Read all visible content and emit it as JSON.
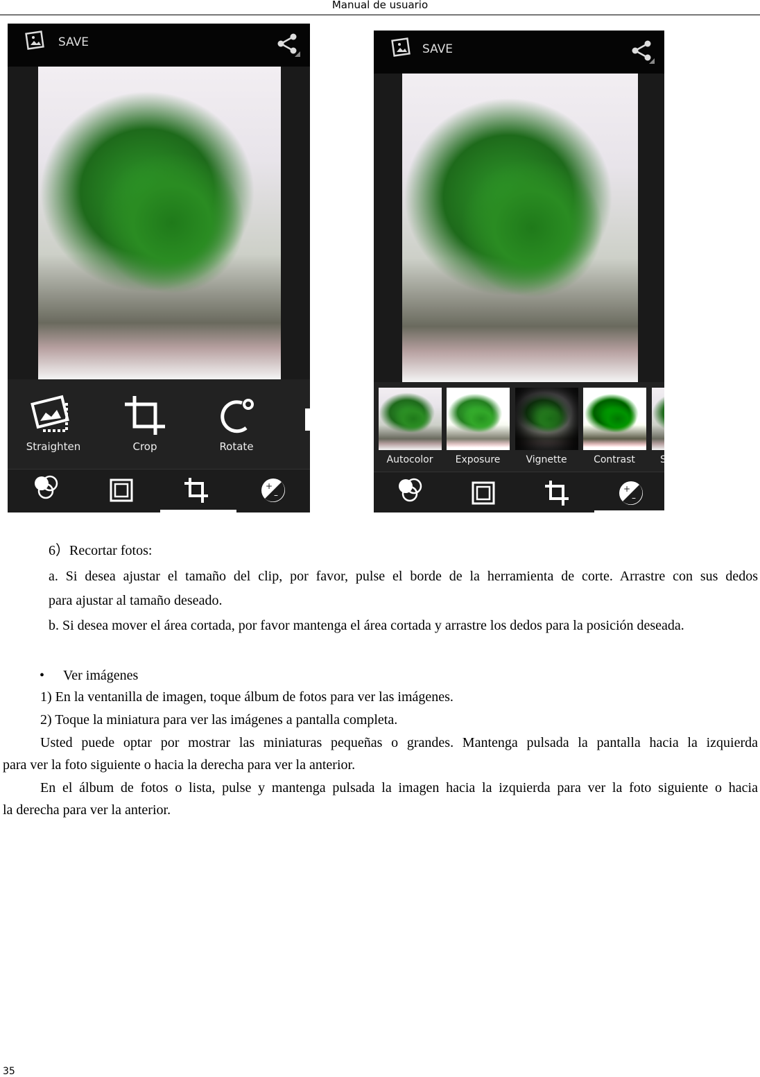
{
  "header": {
    "title": "Manual de usuario"
  },
  "page_number": "35",
  "screenshot_left": {
    "save_label": "SAVE",
    "tools": [
      {
        "label": "Straighten",
        "icon": "straighten-icon"
      },
      {
        "label": "Crop",
        "icon": "crop-icon"
      },
      {
        "label": "Rotate",
        "icon": "rotate-icon"
      }
    ],
    "nav": [
      "filters-icon",
      "border-icon",
      "crop-tab-icon",
      "exposure-icon"
    ],
    "active_nav": "crop-tab-icon"
  },
  "screenshot_right": {
    "save_label": "SAVE",
    "filters": [
      {
        "label": "Autocolor"
      },
      {
        "label": "Exposure"
      },
      {
        "label": "Vignette"
      },
      {
        "label": "Contrast"
      },
      {
        "label": "S"
      }
    ],
    "nav": [
      "filters-icon",
      "border-icon",
      "crop-tab-icon",
      "exposure-icon"
    ],
    "active_nav": "exposure-icon"
  },
  "body": {
    "section_title": "6）Recortar fotos:",
    "item_a_line1": "a. Si desea ajustar el tamaño del clip, por favor, pulse el borde de la herramienta de corte. Arrastre con sus dedos",
    "item_a_line2": "para ajustar al tamaño deseado.",
    "item_b": "b. Si desea mover el área cortada, por favor mantenga el área cortada y arrastre los dedos para la posición deseada.",
    "bullet": "Ver imágenes",
    "step1": "1) En la ventanilla de imagen, toque álbum de fotos para ver las imágenes.",
    "step2": "2) Toque la miniatura para ver las imágenes a pantalla completa.",
    "para1_line1": "Usted puede optar por mostrar las miniaturas pequeñas o grandes. Mantenga pulsada la pantalla hacia la izquierda",
    "para1_line2": "para ver la foto siguiente o hacia la derecha para ver la anterior.",
    "para2_line1": "En el álbum de fotos o lista, pulse y mantenga pulsada la imagen hacia la izquierda para ver la foto siguiente o hacia",
    "para2_line2": "la derecha para ver la anterior."
  }
}
